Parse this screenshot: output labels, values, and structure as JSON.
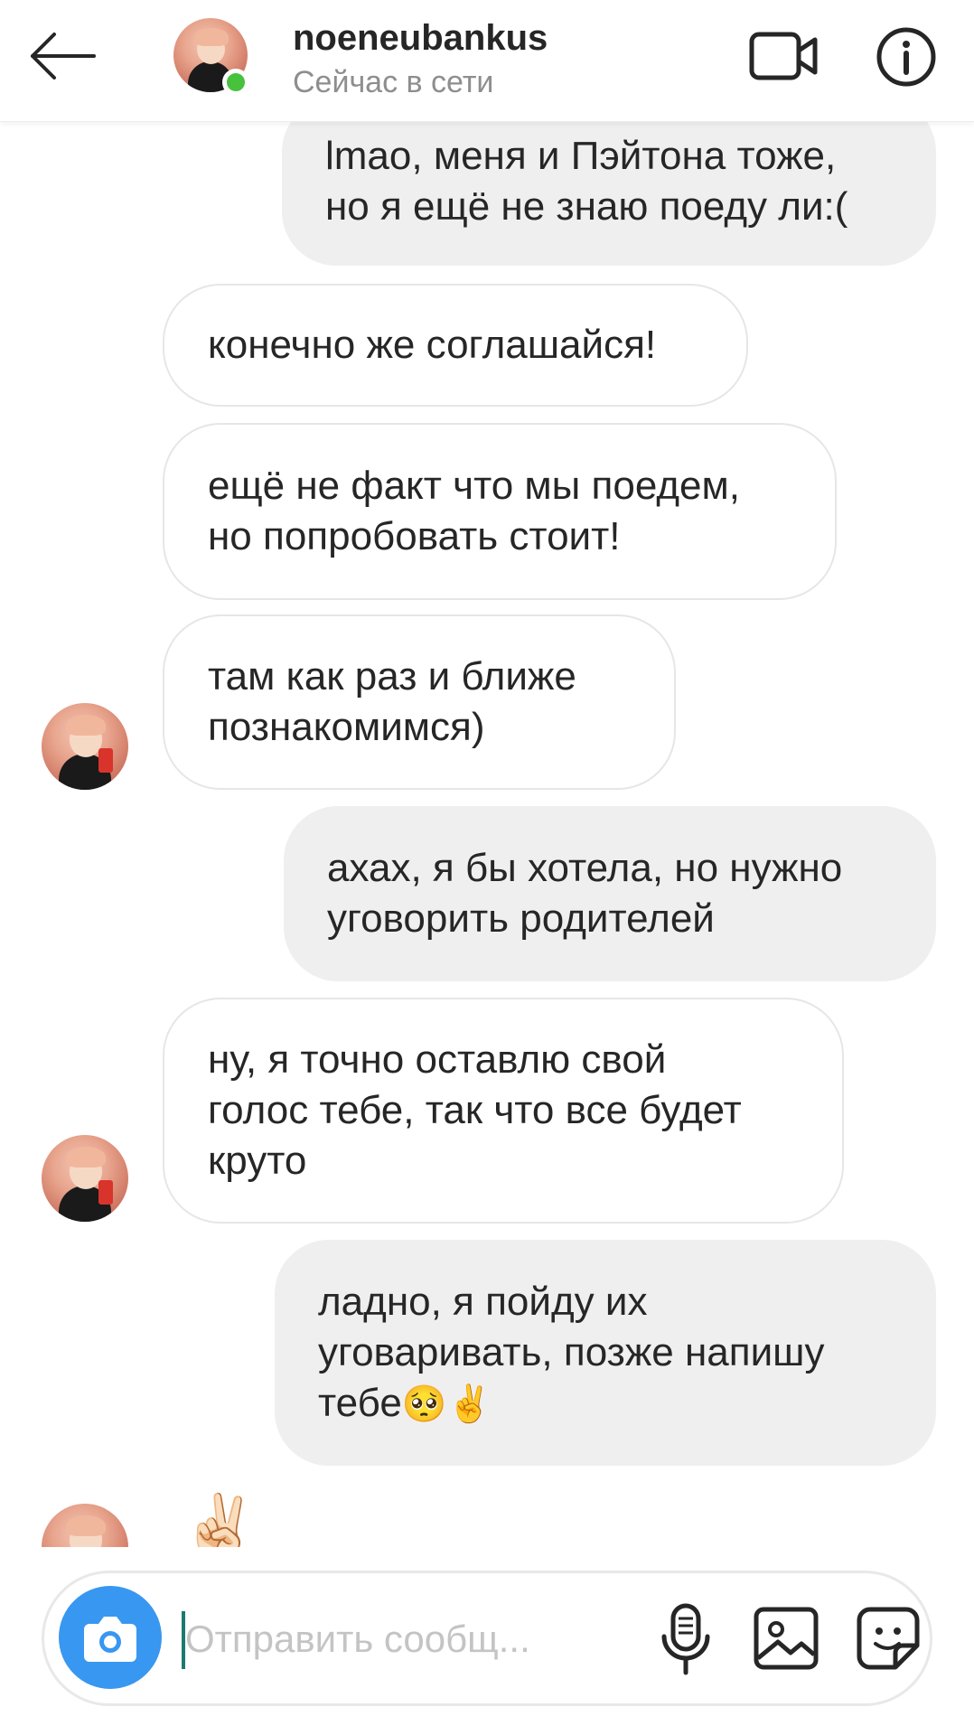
{
  "header": {
    "username": "noeneubankus",
    "status": "Сейчас в сети",
    "online_color": "#46c23d",
    "icons": {
      "back": "arrow-left-icon",
      "video": "video-camera-icon",
      "info": "info-icon"
    }
  },
  "messages": [
    {
      "side": "outgoing",
      "text": "lmao, меня и Пэйтона тоже,\nно я ещё не знаю поеду ли:("
    },
    {
      "side": "incoming",
      "text": "конечно же соглашайся!"
    },
    {
      "side": "incoming",
      "text": "ещё не факт что мы поедем,\nно попробовать стоит!"
    },
    {
      "side": "incoming",
      "text": "там как раз и ближе\nпознакомимся)"
    },
    {
      "side": "outgoing",
      "text": "ахах, я бы хотела, но нужно\nуговорить родителей"
    },
    {
      "side": "incoming",
      "text": "ну, я точно оставлю свой\nголос тебе, так что все будет\nкруто"
    },
    {
      "side": "outgoing",
      "text": "ладно, я пойду их\nуговаривать, позже напишу\nтебе",
      "emoji": "🥺✌️"
    },
    {
      "side": "incoming",
      "emoji": "✌🏻"
    }
  ],
  "composer": {
    "placeholder": "Отправить сообщ...",
    "accent": "#3897f0",
    "icons": {
      "camera": "camera-icon",
      "mic": "microphone-icon",
      "gallery": "image-gallery-icon",
      "sticker": "sticker-icon"
    }
  },
  "colors": {
    "outgoing_bubble": "#efefef",
    "incoming_border": "#e6e6e6",
    "text": "#262626",
    "muted": "#8e8e8e"
  }
}
